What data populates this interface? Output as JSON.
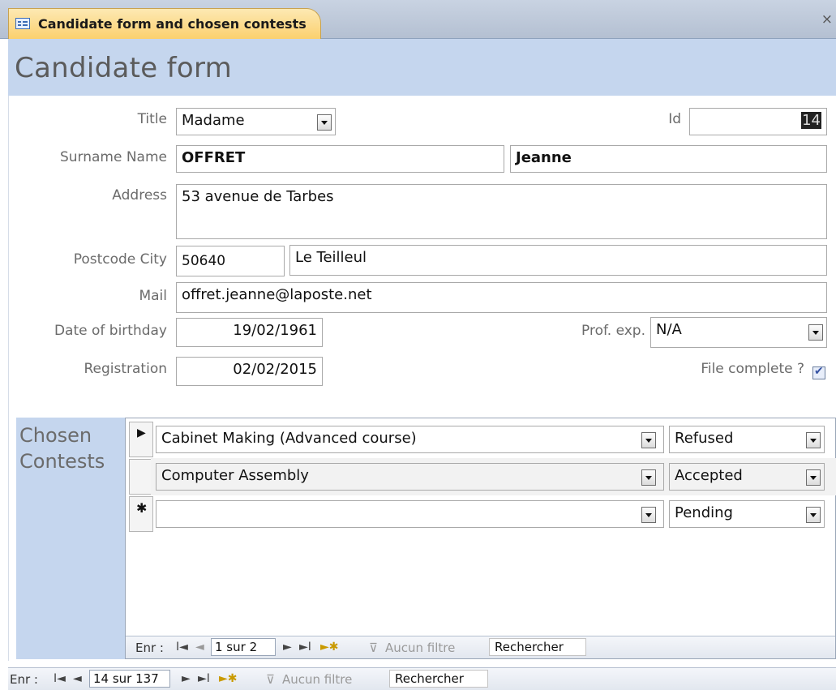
{
  "tab": {
    "label": "Candidate form and chosen contests",
    "close_glyph": "×"
  },
  "header": {
    "title": "Candidate form"
  },
  "form": {
    "title_label": "Title",
    "title_value": "Madame",
    "id_label": "Id",
    "id_value": "14",
    "surname_name_label": "Surname  Name",
    "surname_value": "OFFRET",
    "name_value": "Jeanne",
    "address_label": "Address",
    "address_value": "53 avenue de Tarbes",
    "postcode_city_label": "Postcode  City",
    "postcode_value": "50640",
    "city_value": "Le Teilleul",
    "mail_label": "Mail",
    "mail_value": "offret.jeanne@laposte.net",
    "birthday_label": "Date of birthday",
    "birthday_value": "19/02/1961",
    "profexp_label": "Prof. exp.",
    "profexp_value": "N/A",
    "registration_label": "Registration",
    "registration_value": "02/02/2015",
    "filecomplete_label": "File complete ?",
    "filecomplete_checked": true
  },
  "subform": {
    "title_line1": "Chosen",
    "title_line2": "Contests",
    "rows": [
      {
        "selector": "▶",
        "contest": "Cabinet Making (Advanced course)",
        "status": "Refused"
      },
      {
        "selector": "",
        "contest": "Computer Assembly",
        "status": "Accepted"
      },
      {
        "selector": "✱",
        "contest": "",
        "status": "Pending"
      }
    ],
    "nav": {
      "label": "Enr :",
      "first": "I◄",
      "prev": "◄",
      "position": "1 sur 2",
      "next": "►",
      "last": "►I",
      "new": "►✱",
      "filter_icon": "⊽",
      "filter": "Aucun filtre",
      "search": "Rechercher"
    }
  },
  "mainnav": {
    "label": "Enr :",
    "first": "I◄",
    "prev": "◄",
    "position": "14 sur 137",
    "next": "►",
    "last": "►I",
    "new": "►✱",
    "filter_icon": "⊽",
    "filter": "Aucun filtre",
    "search": "Rechercher"
  },
  "colors": {
    "header_band": "#c5d6ee",
    "tab_active": "#fbd06e"
  }
}
